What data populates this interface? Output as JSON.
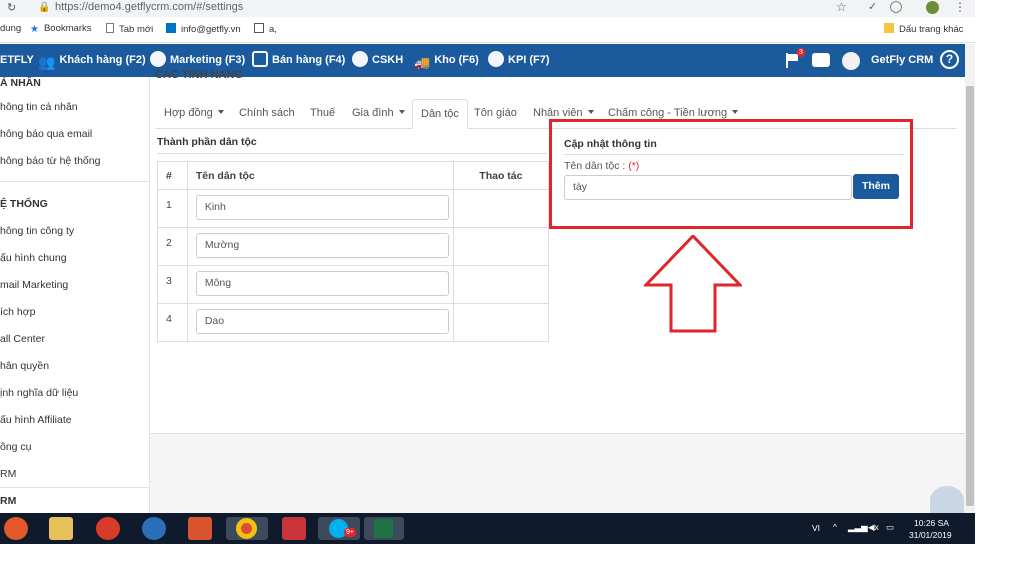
{
  "browser": {
    "url": "https://demo4.getflycrm.com/#/settings",
    "bookmarks": [
      "dung",
      "Bookmarks",
      "Tab mới",
      "info@getfly.vn",
      "a,",
      "Dấu trang khác"
    ]
  },
  "nav": {
    "brand": "ETFLY",
    "items": [
      "Khách hàng (F2)",
      "Marketing (F3)",
      "Bán hàng (F4)",
      "CSKH",
      "Kho (F6)",
      "KPI (F7)"
    ],
    "notification_count": "3",
    "user_name": "GetFly CRM",
    "help_label": "?"
  },
  "sidebar": {
    "section_top": "Á NHÂN",
    "personal": [
      "hông tin cá nhân",
      "hông báo qua email",
      "hông báo từ hệ thống"
    ],
    "section_system": "Ệ THỐNG",
    "system": [
      "hông tin công ty",
      "ấu hình chung",
      "mail Marketing",
      "ích hợp",
      "all Center",
      "hân quyền",
      "ịnh nghĩa dữ liệu",
      "ấu hình Affiliate",
      "ông cụ",
      "RM"
    ],
    "section_bottom": "RM"
  },
  "main": {
    "header_partial": "CAC TINH NANG",
    "tabs": [
      "Hợp đồng",
      "Chính sách",
      "Thuế",
      "Gia đình",
      "Dân tộc",
      "Tôn giáo",
      "Nhân viên",
      "Chấm công - Tiền lương"
    ],
    "section_title": "Thành phần dân tộc",
    "table": {
      "headers": [
        "#",
        "Tên dân tộc",
        "Thao tác"
      ],
      "rows": [
        {
          "index": "1",
          "name": "Kinh"
        },
        {
          "index": "2",
          "name": "Mường"
        },
        {
          "index": "3",
          "name": "Mông"
        },
        {
          "index": "4",
          "name": "Dao"
        }
      ]
    },
    "update": {
      "title": "Cập nhật thông tin",
      "field_label": "Tên dân tộc :",
      "required_mark": "(*)",
      "field_value": "tày",
      "submit_label": "Thêm"
    }
  },
  "taskbar": {
    "lang": "VI",
    "time": "10:26 SA",
    "date": "31/01/2019",
    "skype_badge": "9+"
  },
  "colors": {
    "nav": "#1b5b9d",
    "highlight": "#e1262b",
    "button": "#1b5b9d"
  }
}
